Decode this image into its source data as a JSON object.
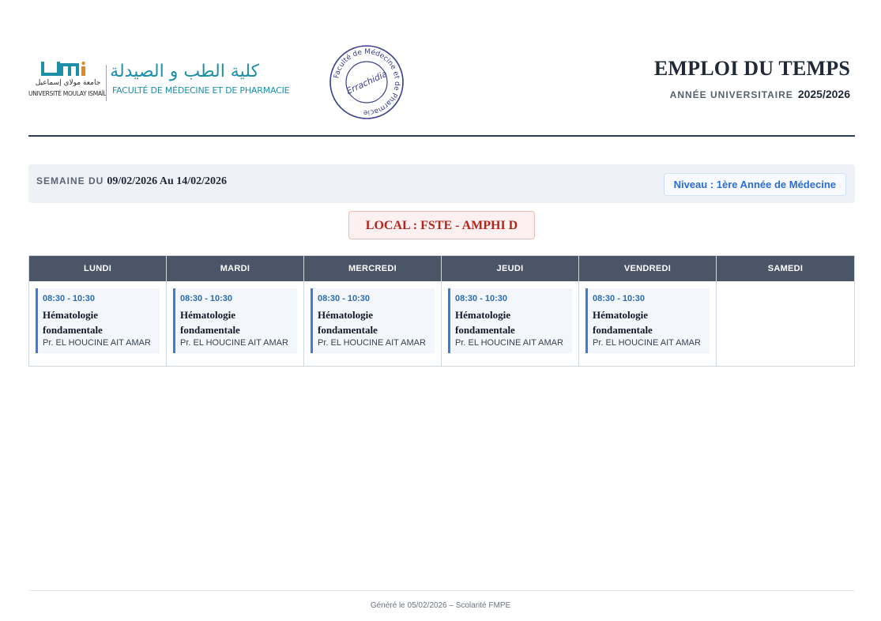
{
  "header": {
    "umi_text": "UMI",
    "university_ar": "جامعة مولاي إسماعيل",
    "university_fr": "UNIVERSITÉ MOULAY ISMAÏL",
    "faculty_ar": "كلية الطب و الصيدلة",
    "faculty_fr": "FACULTÉ DE MÉDECINE ET DE PHARMACIE",
    "stamp_center": "Errachidia",
    "stamp_ring": "Faculté de Médecine et de Pharmacie",
    "title": "EMPLOI DU TEMPS",
    "year_label": "ANNÉE UNIVERSITAIRE",
    "year_value": "2025/2026"
  },
  "week": {
    "label": "SEMAINE DU",
    "dates": "09/02/2026 Au 14/02/2026",
    "level": "Niveau : 1ère Année de Médecine"
  },
  "local": "LOCAL : FSTE - AMPHI D",
  "days": [
    {
      "name": "LUNDI",
      "course": {
        "time": "08:30 - 10:30",
        "title_l1": "Hématologie",
        "title_l2": "fondamentale",
        "professor": "Pr. EL HOUCINE AIT AMAR"
      }
    },
    {
      "name": "MARDI",
      "course": {
        "time": "08:30 - 10:30",
        "title_l1": "Hématologie",
        "title_l2": "fondamentale",
        "professor": "Pr. EL HOUCINE AIT AMAR"
      }
    },
    {
      "name": "MERCREDI",
      "course": {
        "time": "08:30 - 10:30",
        "title_l1": "Hématologie",
        "title_l2": "fondamentale",
        "professor": "Pr. EL HOUCINE AIT AMAR"
      }
    },
    {
      "name": "JEUDI",
      "course": {
        "time": "08:30 - 10:30",
        "title_l1": "Hématologie",
        "title_l2": "fondamentale",
        "professor": "Pr. EL HOUCINE AIT AMAR"
      }
    },
    {
      "name": "VENDREDI",
      "course": {
        "time": "08:30 - 10:30",
        "title_l1": "Hématologie",
        "title_l2": "fondamentale",
        "professor": "Pr. EL HOUCINE AIT AMAR"
      }
    },
    {
      "name": "SAMEDI",
      "course": null
    }
  ],
  "footer": "Généré le 05/02/2026 – Scolarité FMPE",
  "colors": {
    "navy": "#2c3e5c",
    "header_cell": "#4a5568",
    "accent_blue": "#3b7dd8",
    "local_red": "#b3261e",
    "faculty_teal": "#1f8fa8",
    "stamp_blue": "#3a3f8f"
  }
}
